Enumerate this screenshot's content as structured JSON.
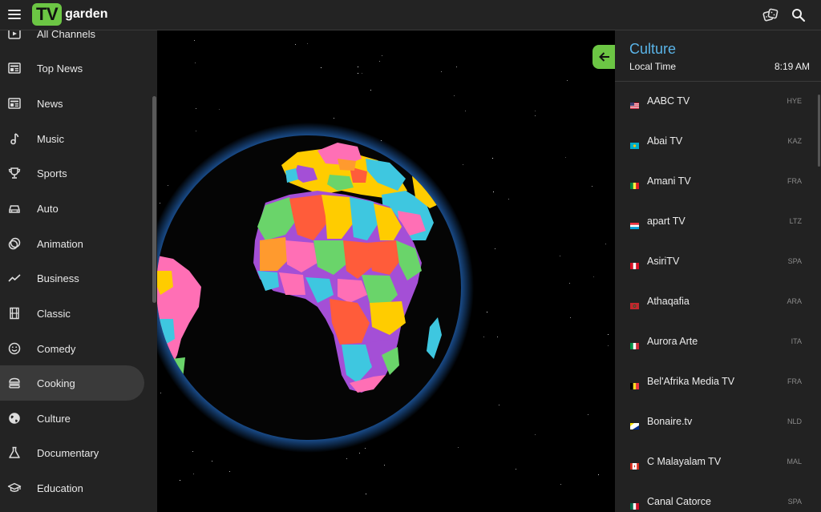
{
  "header": {
    "logo_tv": "TV",
    "logo_garden": "garden",
    "icons": [
      "menu-icon",
      "random-channel-icon",
      "search-icon"
    ]
  },
  "sidebar": {
    "items": [
      {
        "label": "All Channels",
        "icon": "play-box-icon"
      },
      {
        "label": "Top News",
        "icon": "newspaper-icon"
      },
      {
        "label": "News",
        "icon": "newspaper-icon"
      },
      {
        "label": "Music",
        "icon": "music-note-icon"
      },
      {
        "label": "Sports",
        "icon": "trophy-icon"
      },
      {
        "label": "Auto",
        "icon": "car-icon"
      },
      {
        "label": "Animation",
        "icon": "animation-icon"
      },
      {
        "label": "Business",
        "icon": "trend-icon"
      },
      {
        "label": "Classic",
        "icon": "film-icon"
      },
      {
        "label": "Comedy",
        "icon": "smiley-icon"
      },
      {
        "label": "Cooking",
        "icon": "burger-icon"
      },
      {
        "label": "Culture",
        "icon": "globe-icon"
      },
      {
        "label": "Documentary",
        "icon": "flask-icon"
      },
      {
        "label": "Education",
        "icon": "graduation-cap-icon"
      }
    ],
    "active_item": "Cooking"
  },
  "panel": {
    "title": "Culture",
    "local_time_label": "Local Time",
    "local_time_value": "8:19 AM",
    "channels": [
      {
        "name": "AABC TV",
        "lang": "HYE",
        "flag": "us"
      },
      {
        "name": "Abai TV",
        "lang": "KAZ",
        "flag": "kz"
      },
      {
        "name": "Amani TV",
        "lang": "FRA",
        "flag": "sn"
      },
      {
        "name": "apart TV",
        "lang": "LTZ",
        "flag": "lu"
      },
      {
        "name": "AsiriTV",
        "lang": "SPA",
        "flag": "pe"
      },
      {
        "name": "Athaqafia",
        "lang": "ARA",
        "flag": "ma"
      },
      {
        "name": "Aurora Arte",
        "lang": "ITA",
        "flag": "it"
      },
      {
        "name": "Bel'Afrika Media TV",
        "lang": "FRA",
        "flag": "be"
      },
      {
        "name": "Bonaire.tv",
        "lang": "NLD",
        "flag": "bq"
      },
      {
        "name": "C Malayalam TV",
        "lang": "MAL",
        "flag": "ca"
      },
      {
        "name": "Canal Catorce",
        "lang": "SPA",
        "flag": "mx"
      }
    ]
  },
  "colors": {
    "accent_green": "#6cc644",
    "title_blue": "#5ab4e8",
    "background_dark": "#232323"
  }
}
